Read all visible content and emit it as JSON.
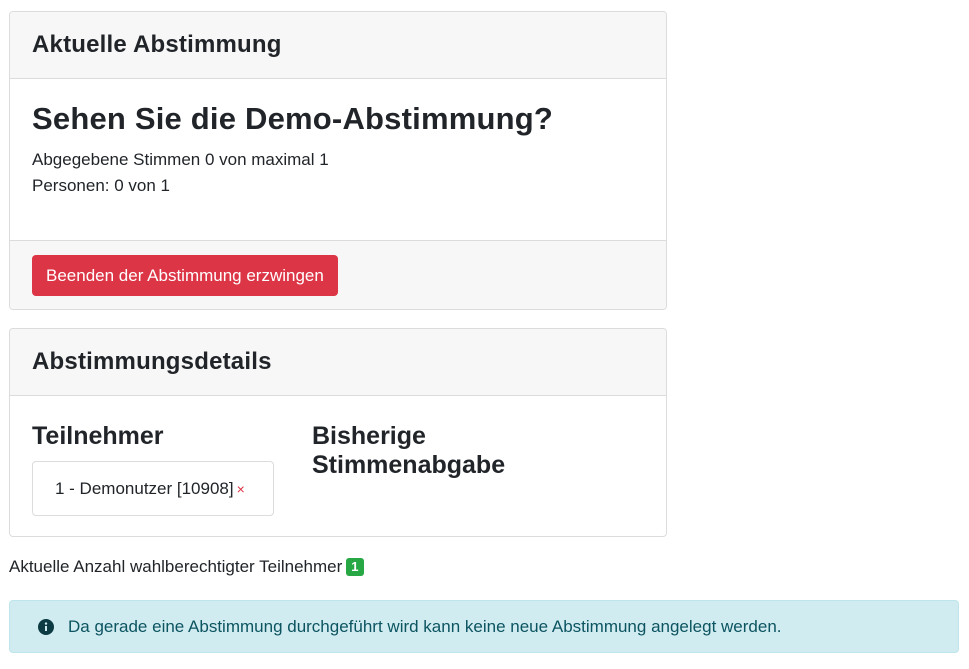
{
  "current_poll": {
    "header": "Aktuelle Abstimmung",
    "question": "Sehen Sie die Demo-Abstimmung?",
    "votes_line": "Abgegebene Stimmen 0 von maximal 1",
    "persons_line": "Personen: 0 von 1",
    "force_end_button": "Beenden der Abstimmung erzwingen"
  },
  "details": {
    "header": "Abstimmungsdetails",
    "participants_title": "Teilnehmer",
    "votes_title": "Bisherige Stimmenabgabe",
    "participants": [
      {
        "label": "1 - Demonutzer [10908]",
        "remove_icon": "×"
      }
    ]
  },
  "eligible": {
    "label": "Aktuelle Anzahl wahlberechtigter Teilnehmer",
    "count": "1"
  },
  "alert": {
    "icon": "info-circle-icon",
    "text": "Da gerade eine Abstimmung durchgeführt wird kann keine neue Abstimmung angelegt werden."
  },
  "colors": {
    "danger": "#dc3545",
    "success": "#28a745",
    "info_bg": "#d1ecf1",
    "info_text": "#0c5460"
  }
}
